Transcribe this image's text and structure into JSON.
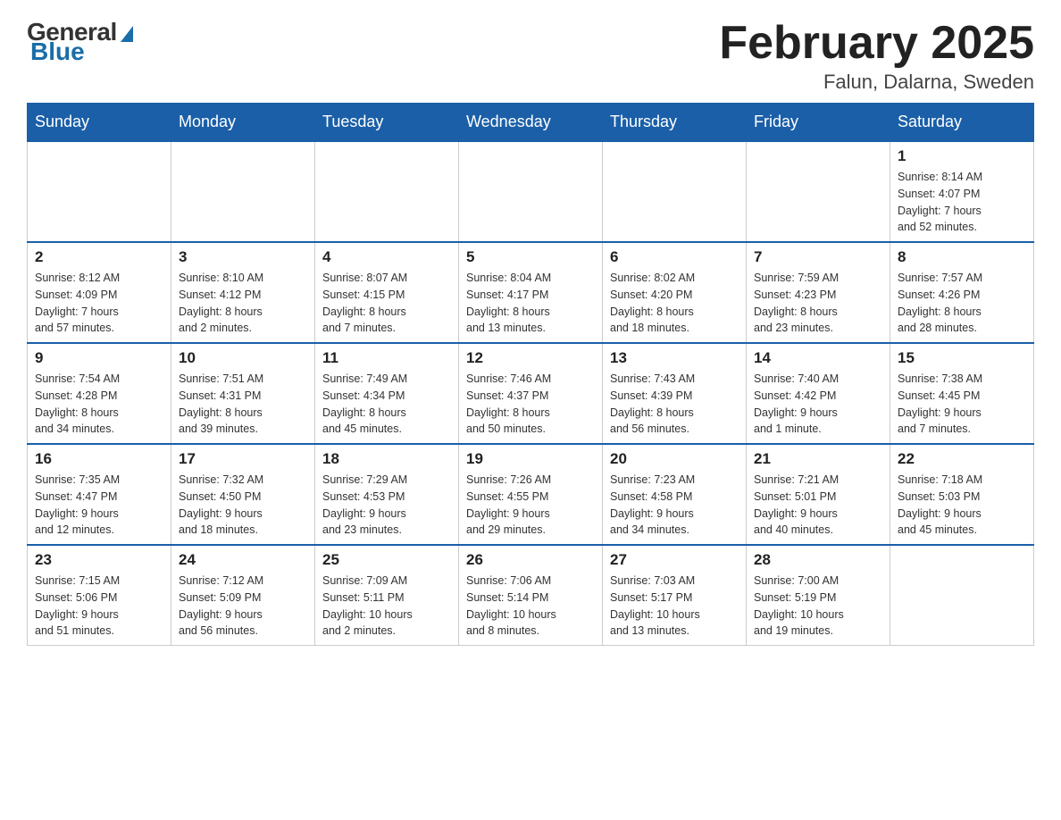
{
  "header": {
    "logo_general": "General",
    "logo_blue": "Blue",
    "month_title": "February 2025",
    "location": "Falun, Dalarna, Sweden"
  },
  "days_of_week": [
    "Sunday",
    "Monday",
    "Tuesday",
    "Wednesday",
    "Thursday",
    "Friday",
    "Saturday"
  ],
  "weeks": [
    [
      {
        "day": "",
        "info": ""
      },
      {
        "day": "",
        "info": ""
      },
      {
        "day": "",
        "info": ""
      },
      {
        "day": "",
        "info": ""
      },
      {
        "day": "",
        "info": ""
      },
      {
        "day": "",
        "info": ""
      },
      {
        "day": "1",
        "info": "Sunrise: 8:14 AM\nSunset: 4:07 PM\nDaylight: 7 hours\nand 52 minutes."
      }
    ],
    [
      {
        "day": "2",
        "info": "Sunrise: 8:12 AM\nSunset: 4:09 PM\nDaylight: 7 hours\nand 57 minutes."
      },
      {
        "day": "3",
        "info": "Sunrise: 8:10 AM\nSunset: 4:12 PM\nDaylight: 8 hours\nand 2 minutes."
      },
      {
        "day": "4",
        "info": "Sunrise: 8:07 AM\nSunset: 4:15 PM\nDaylight: 8 hours\nand 7 minutes."
      },
      {
        "day": "5",
        "info": "Sunrise: 8:04 AM\nSunset: 4:17 PM\nDaylight: 8 hours\nand 13 minutes."
      },
      {
        "day": "6",
        "info": "Sunrise: 8:02 AM\nSunset: 4:20 PM\nDaylight: 8 hours\nand 18 minutes."
      },
      {
        "day": "7",
        "info": "Sunrise: 7:59 AM\nSunset: 4:23 PM\nDaylight: 8 hours\nand 23 minutes."
      },
      {
        "day": "8",
        "info": "Sunrise: 7:57 AM\nSunset: 4:26 PM\nDaylight: 8 hours\nand 28 minutes."
      }
    ],
    [
      {
        "day": "9",
        "info": "Sunrise: 7:54 AM\nSunset: 4:28 PM\nDaylight: 8 hours\nand 34 minutes."
      },
      {
        "day": "10",
        "info": "Sunrise: 7:51 AM\nSunset: 4:31 PM\nDaylight: 8 hours\nand 39 minutes."
      },
      {
        "day": "11",
        "info": "Sunrise: 7:49 AM\nSunset: 4:34 PM\nDaylight: 8 hours\nand 45 minutes."
      },
      {
        "day": "12",
        "info": "Sunrise: 7:46 AM\nSunset: 4:37 PM\nDaylight: 8 hours\nand 50 minutes."
      },
      {
        "day": "13",
        "info": "Sunrise: 7:43 AM\nSunset: 4:39 PM\nDaylight: 8 hours\nand 56 minutes."
      },
      {
        "day": "14",
        "info": "Sunrise: 7:40 AM\nSunset: 4:42 PM\nDaylight: 9 hours\nand 1 minute."
      },
      {
        "day": "15",
        "info": "Sunrise: 7:38 AM\nSunset: 4:45 PM\nDaylight: 9 hours\nand 7 minutes."
      }
    ],
    [
      {
        "day": "16",
        "info": "Sunrise: 7:35 AM\nSunset: 4:47 PM\nDaylight: 9 hours\nand 12 minutes."
      },
      {
        "day": "17",
        "info": "Sunrise: 7:32 AM\nSunset: 4:50 PM\nDaylight: 9 hours\nand 18 minutes."
      },
      {
        "day": "18",
        "info": "Sunrise: 7:29 AM\nSunset: 4:53 PM\nDaylight: 9 hours\nand 23 minutes."
      },
      {
        "day": "19",
        "info": "Sunrise: 7:26 AM\nSunset: 4:55 PM\nDaylight: 9 hours\nand 29 minutes."
      },
      {
        "day": "20",
        "info": "Sunrise: 7:23 AM\nSunset: 4:58 PM\nDaylight: 9 hours\nand 34 minutes."
      },
      {
        "day": "21",
        "info": "Sunrise: 7:21 AM\nSunset: 5:01 PM\nDaylight: 9 hours\nand 40 minutes."
      },
      {
        "day": "22",
        "info": "Sunrise: 7:18 AM\nSunset: 5:03 PM\nDaylight: 9 hours\nand 45 minutes."
      }
    ],
    [
      {
        "day": "23",
        "info": "Sunrise: 7:15 AM\nSunset: 5:06 PM\nDaylight: 9 hours\nand 51 minutes."
      },
      {
        "day": "24",
        "info": "Sunrise: 7:12 AM\nSunset: 5:09 PM\nDaylight: 9 hours\nand 56 minutes."
      },
      {
        "day": "25",
        "info": "Sunrise: 7:09 AM\nSunset: 5:11 PM\nDaylight: 10 hours\nand 2 minutes."
      },
      {
        "day": "26",
        "info": "Sunrise: 7:06 AM\nSunset: 5:14 PM\nDaylight: 10 hours\nand 8 minutes."
      },
      {
        "day": "27",
        "info": "Sunrise: 7:03 AM\nSunset: 5:17 PM\nDaylight: 10 hours\nand 13 minutes."
      },
      {
        "day": "28",
        "info": "Sunrise: 7:00 AM\nSunset: 5:19 PM\nDaylight: 10 hours\nand 19 minutes."
      },
      {
        "day": "",
        "info": ""
      }
    ]
  ]
}
